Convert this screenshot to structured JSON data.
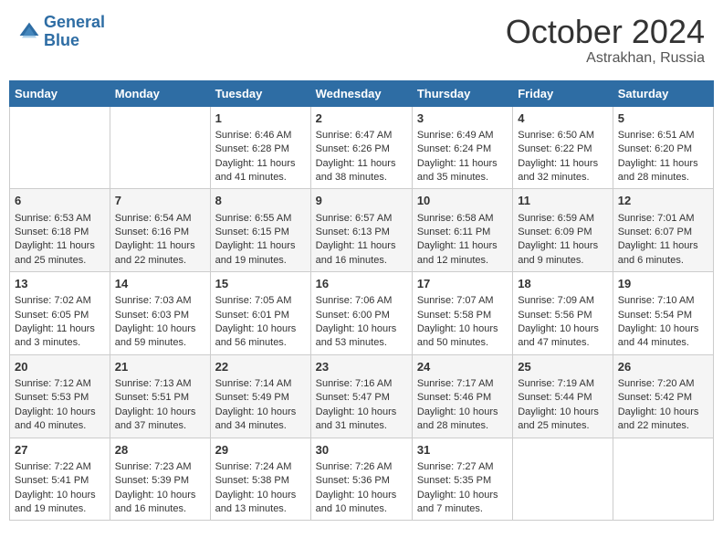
{
  "header": {
    "logo_line1": "General",
    "logo_line2": "Blue",
    "month": "October 2024",
    "location": "Astrakhan, Russia"
  },
  "days_of_week": [
    "Sunday",
    "Monday",
    "Tuesday",
    "Wednesday",
    "Thursday",
    "Friday",
    "Saturday"
  ],
  "weeks": [
    [
      {
        "day": "",
        "sunrise": "",
        "sunset": "",
        "daylight": ""
      },
      {
        "day": "",
        "sunrise": "",
        "sunset": "",
        "daylight": ""
      },
      {
        "day": "1",
        "sunrise": "Sunrise: 6:46 AM",
        "sunset": "Sunset: 6:28 PM",
        "daylight": "Daylight: 11 hours and 41 minutes."
      },
      {
        "day": "2",
        "sunrise": "Sunrise: 6:47 AM",
        "sunset": "Sunset: 6:26 PM",
        "daylight": "Daylight: 11 hours and 38 minutes."
      },
      {
        "day": "3",
        "sunrise": "Sunrise: 6:49 AM",
        "sunset": "Sunset: 6:24 PM",
        "daylight": "Daylight: 11 hours and 35 minutes."
      },
      {
        "day": "4",
        "sunrise": "Sunrise: 6:50 AM",
        "sunset": "Sunset: 6:22 PM",
        "daylight": "Daylight: 11 hours and 32 minutes."
      },
      {
        "day": "5",
        "sunrise": "Sunrise: 6:51 AM",
        "sunset": "Sunset: 6:20 PM",
        "daylight": "Daylight: 11 hours and 28 minutes."
      }
    ],
    [
      {
        "day": "6",
        "sunrise": "Sunrise: 6:53 AM",
        "sunset": "Sunset: 6:18 PM",
        "daylight": "Daylight: 11 hours and 25 minutes."
      },
      {
        "day": "7",
        "sunrise": "Sunrise: 6:54 AM",
        "sunset": "Sunset: 6:16 PM",
        "daylight": "Daylight: 11 hours and 22 minutes."
      },
      {
        "day": "8",
        "sunrise": "Sunrise: 6:55 AM",
        "sunset": "Sunset: 6:15 PM",
        "daylight": "Daylight: 11 hours and 19 minutes."
      },
      {
        "day": "9",
        "sunrise": "Sunrise: 6:57 AM",
        "sunset": "Sunset: 6:13 PM",
        "daylight": "Daylight: 11 hours and 16 minutes."
      },
      {
        "day": "10",
        "sunrise": "Sunrise: 6:58 AM",
        "sunset": "Sunset: 6:11 PM",
        "daylight": "Daylight: 11 hours and 12 minutes."
      },
      {
        "day": "11",
        "sunrise": "Sunrise: 6:59 AM",
        "sunset": "Sunset: 6:09 PM",
        "daylight": "Daylight: 11 hours and 9 minutes."
      },
      {
        "day": "12",
        "sunrise": "Sunrise: 7:01 AM",
        "sunset": "Sunset: 6:07 PM",
        "daylight": "Daylight: 11 hours and 6 minutes."
      }
    ],
    [
      {
        "day": "13",
        "sunrise": "Sunrise: 7:02 AM",
        "sunset": "Sunset: 6:05 PM",
        "daylight": "Daylight: 11 hours and 3 minutes."
      },
      {
        "day": "14",
        "sunrise": "Sunrise: 7:03 AM",
        "sunset": "Sunset: 6:03 PM",
        "daylight": "Daylight: 10 hours and 59 minutes."
      },
      {
        "day": "15",
        "sunrise": "Sunrise: 7:05 AM",
        "sunset": "Sunset: 6:01 PM",
        "daylight": "Daylight: 10 hours and 56 minutes."
      },
      {
        "day": "16",
        "sunrise": "Sunrise: 7:06 AM",
        "sunset": "Sunset: 6:00 PM",
        "daylight": "Daylight: 10 hours and 53 minutes."
      },
      {
        "day": "17",
        "sunrise": "Sunrise: 7:07 AM",
        "sunset": "Sunset: 5:58 PM",
        "daylight": "Daylight: 10 hours and 50 minutes."
      },
      {
        "day": "18",
        "sunrise": "Sunrise: 7:09 AM",
        "sunset": "Sunset: 5:56 PM",
        "daylight": "Daylight: 10 hours and 47 minutes."
      },
      {
        "day": "19",
        "sunrise": "Sunrise: 7:10 AM",
        "sunset": "Sunset: 5:54 PM",
        "daylight": "Daylight: 10 hours and 44 minutes."
      }
    ],
    [
      {
        "day": "20",
        "sunrise": "Sunrise: 7:12 AM",
        "sunset": "Sunset: 5:53 PM",
        "daylight": "Daylight: 10 hours and 40 minutes."
      },
      {
        "day": "21",
        "sunrise": "Sunrise: 7:13 AM",
        "sunset": "Sunset: 5:51 PM",
        "daylight": "Daylight: 10 hours and 37 minutes."
      },
      {
        "day": "22",
        "sunrise": "Sunrise: 7:14 AM",
        "sunset": "Sunset: 5:49 PM",
        "daylight": "Daylight: 10 hours and 34 minutes."
      },
      {
        "day": "23",
        "sunrise": "Sunrise: 7:16 AM",
        "sunset": "Sunset: 5:47 PM",
        "daylight": "Daylight: 10 hours and 31 minutes."
      },
      {
        "day": "24",
        "sunrise": "Sunrise: 7:17 AM",
        "sunset": "Sunset: 5:46 PM",
        "daylight": "Daylight: 10 hours and 28 minutes."
      },
      {
        "day": "25",
        "sunrise": "Sunrise: 7:19 AM",
        "sunset": "Sunset: 5:44 PM",
        "daylight": "Daylight: 10 hours and 25 minutes."
      },
      {
        "day": "26",
        "sunrise": "Sunrise: 7:20 AM",
        "sunset": "Sunset: 5:42 PM",
        "daylight": "Daylight: 10 hours and 22 minutes."
      }
    ],
    [
      {
        "day": "27",
        "sunrise": "Sunrise: 7:22 AM",
        "sunset": "Sunset: 5:41 PM",
        "daylight": "Daylight: 10 hours and 19 minutes."
      },
      {
        "day": "28",
        "sunrise": "Sunrise: 7:23 AM",
        "sunset": "Sunset: 5:39 PM",
        "daylight": "Daylight: 10 hours and 16 minutes."
      },
      {
        "day": "29",
        "sunrise": "Sunrise: 7:24 AM",
        "sunset": "Sunset: 5:38 PM",
        "daylight": "Daylight: 10 hours and 13 minutes."
      },
      {
        "day": "30",
        "sunrise": "Sunrise: 7:26 AM",
        "sunset": "Sunset: 5:36 PM",
        "daylight": "Daylight: 10 hours and 10 minutes."
      },
      {
        "day": "31",
        "sunrise": "Sunrise: 7:27 AM",
        "sunset": "Sunset: 5:35 PM",
        "daylight": "Daylight: 10 hours and 7 minutes."
      },
      {
        "day": "",
        "sunrise": "",
        "sunset": "",
        "daylight": ""
      },
      {
        "day": "",
        "sunrise": "",
        "sunset": "",
        "daylight": ""
      }
    ]
  ]
}
